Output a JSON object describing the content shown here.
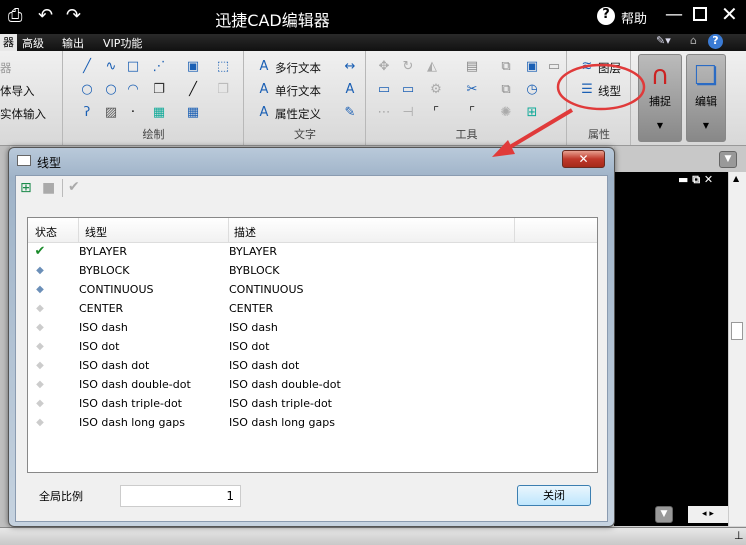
{
  "app": {
    "title": "迅捷CAD编辑器",
    "help": "帮助"
  },
  "tabs": [
    {
      "label": "器"
    },
    {
      "label": "高级"
    },
    {
      "label": "输出"
    },
    {
      "label": "VIP功能"
    }
  ],
  "ribbon": {
    "left_items": [
      "器",
      "体导入",
      "实体输入"
    ],
    "draw": {
      "label": "绘制"
    },
    "text": {
      "label": "文字",
      "items": [
        "多行文本",
        "单行文本",
        "属性定义"
      ]
    },
    "tools": {
      "label": "工具"
    },
    "props": {
      "label": "属性",
      "items": [
        "图层",
        "线型"
      ]
    },
    "snap": {
      "label": "捕捉"
    },
    "edit": {
      "label": "编辑"
    }
  },
  "annotation": {
    "color": "#e03a3a"
  },
  "dialog": {
    "title": "线型",
    "columns": [
      "状态",
      "线型",
      "描述"
    ],
    "rows": [
      {
        "status": "current",
        "name": "BYLAYER",
        "desc": "BYLAYER"
      },
      {
        "status": "used",
        "name": "BYBLOCK",
        "desc": "BYBLOCK"
      },
      {
        "status": "used",
        "name": "CONTINUOUS",
        "desc": "CONTINUOUS"
      },
      {
        "status": "unused",
        "name": "CENTER",
        "desc": "CENTER"
      },
      {
        "status": "unused",
        "name": "ISO dash",
        "desc": "ISO dash"
      },
      {
        "status": "unused",
        "name": "ISO dot",
        "desc": "ISO dot"
      },
      {
        "status": "unused",
        "name": "ISO dash dot",
        "desc": "ISO dash dot"
      },
      {
        "status": "unused",
        "name": "ISO dash double-dot",
        "desc": "ISO dash double-dot"
      },
      {
        "status": "unused",
        "name": "ISO dash triple-dot",
        "desc": "ISO dash triple-dot"
      },
      {
        "status": "unused",
        "name": "ISO dash long gaps",
        "desc": "ISO dash long gaps"
      }
    ],
    "scale_label": "全局比例",
    "scale_value": "1",
    "close_label": "关闭"
  }
}
